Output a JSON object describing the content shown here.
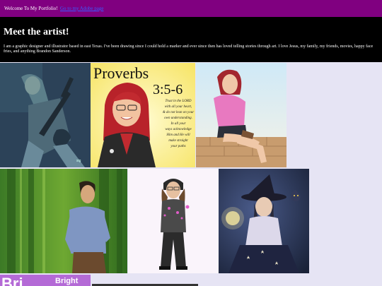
{
  "header": {
    "welcome": "Welcome To My Portfolio!",
    "link": "Go to my Adobe page"
  },
  "intro": {
    "title": "Meet the artist!",
    "bio": "I am a graphic designer and illustrator based in east Texas. I've been drawing since I could hold a marker and ever since then has loved telling stories through art. I love Jesus, my family, my friends, movies, happy face fries, and anything Brandon Sanderson."
  },
  "gallery": {
    "proverbs_title": "Proverbs",
    "proverbs_ref": "3:5-6",
    "proverbs_verse": [
      "Trust in the LORD",
      "with all your heart,",
      "& do not lean on your",
      "own understanding.",
      "In all your",
      "ways acknowledge",
      "Him and He will",
      "make straight",
      "your paths"
    ],
    "bright_logo": [
      "Bri",
      "Bright"
    ]
  },
  "colors": {
    "topbar": "#800080",
    "intro_bg": "#000000",
    "page_bg": "#e6e4f4"
  }
}
